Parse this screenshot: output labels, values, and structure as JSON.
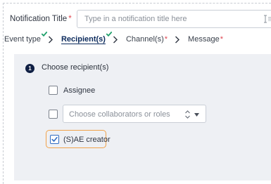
{
  "notification_title": {
    "label": "Notification Title",
    "required_mark": "*",
    "placeholder": "Type in a notification title here",
    "value": ""
  },
  "steps": [
    {
      "label": "Event type",
      "completed": true,
      "active": false,
      "required": false
    },
    {
      "label": "Recipient(s)",
      "completed": true,
      "active": true,
      "required": false
    },
    {
      "label": "Channel(s)",
      "completed": false,
      "active": false,
      "required": true
    },
    {
      "label": "Message",
      "completed": false,
      "active": false,
      "required": true
    }
  ],
  "recipients_section": {
    "step_number": "1",
    "heading": "Choose recipient(s)",
    "options": {
      "assignee": {
        "label": "Assignee",
        "checked": false
      },
      "collaborators": {
        "placeholder": "Choose collaborators or roles",
        "checked": false
      },
      "sae_creator": {
        "label": "(S)AE creator",
        "checked": true
      }
    }
  },
  "colors": {
    "accent": "#0b2a5c",
    "completed_check": "#1fa06b",
    "required": "#e0454f",
    "checkbox_checked": "#2f6bc2",
    "highlight_border": "#f0a24a",
    "panel_background": "#eef0f4"
  }
}
